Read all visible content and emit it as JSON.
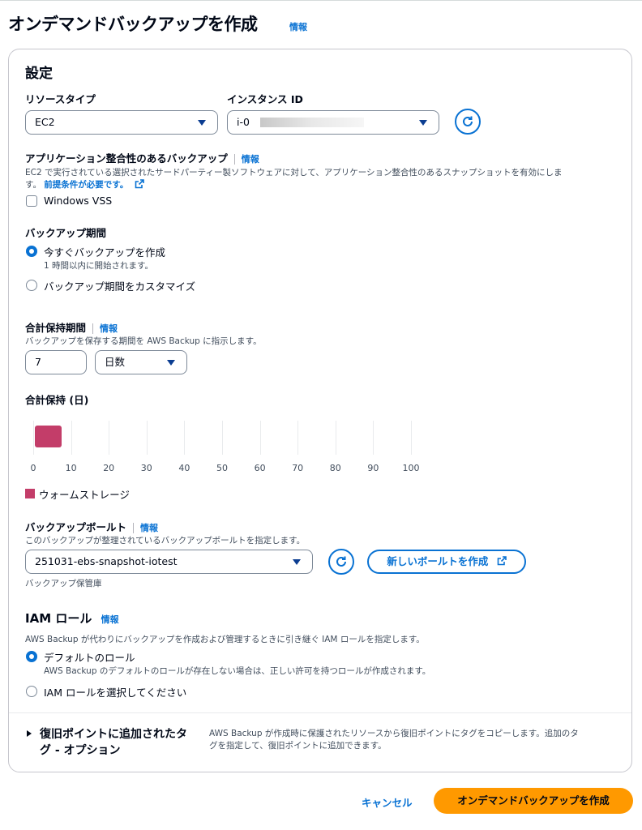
{
  "page": {
    "title": "オンデマンドバックアップを作成",
    "info": "情報"
  },
  "settings": {
    "heading": "設定",
    "resource_type": {
      "label": "リソースタイプ",
      "value": "EC2"
    },
    "instance_id": {
      "label": "インスタンス ID",
      "value": "i-0"
    },
    "app_consistent": {
      "label": "アプリケーション整合性のあるバックアップ",
      "info": "情報",
      "desc": "EC2 で実行されている選択されたサードパーティー製ソフトウェアに対して、アプリケーション整合性のあるスナップショットを有効にしま",
      "desc2": "す。",
      "prereq_link": "前提条件が必要です。",
      "checkbox_label": "Windows VSS",
      "checkbox_checked": false
    },
    "backup_window": {
      "label": "バックアップ期間",
      "options": [
        {
          "label": "今すぐバックアップを作成",
          "sub": "1 時間以内に開始されます。",
          "selected": true
        },
        {
          "label": "バックアップ期間をカスタマイズ",
          "selected": false
        }
      ]
    },
    "retention": {
      "label": "合計保持期間",
      "info": "情報",
      "desc": "バックアップを保存する期間を AWS Backup に指示します。",
      "value": "7",
      "unit": "日数"
    },
    "retention_chart": {
      "title": "合計保持 (日)",
      "legend": "ウォームストレージ",
      "color": "#c33d69"
    },
    "vault": {
      "label": "バックアップボールト",
      "info": "情報",
      "desc": "このバックアップが整理されているバックアップボールトを指定します。",
      "value": "251031-ebs-snapshot-iotest",
      "create_button": "新しいボールトを作成",
      "footnote": "バックアップ保管庫"
    },
    "iam": {
      "label": "IAM ロール",
      "info": "情報",
      "desc": "AWS Backup が代わりにバックアップを作成および管理するときに引き継ぐ IAM ロールを指定します。",
      "options": [
        {
          "label": "デフォルトのロール",
          "sub": "AWS Backup のデフォルトのロールが存在しない場合は、正しい許可を持つロールが作成されます。",
          "selected": true
        },
        {
          "label": "IAM ロールを選択してください",
          "selected": false
        }
      ]
    },
    "tags": {
      "title_line1": "復旧ポイントに追加されたタ",
      "title_line2": "グ - オプション",
      "desc_line1": "AWS Backup が作成時に保護されたリソースから復旧ポイントにタグをコピーします。追加のタ",
      "desc_line2": "グを指定して、復旧ポイントに追加できます。"
    }
  },
  "footer": {
    "cancel": "キャンセル",
    "submit": "オンデマンドバックアップを作成"
  },
  "chart_data": {
    "type": "bar",
    "title": "合計保持 (日)",
    "x_ticks": [
      0,
      10,
      20,
      30,
      40,
      50,
      60,
      70,
      80,
      90,
      100
    ],
    "xlim": [
      0,
      100
    ],
    "series": [
      {
        "name": "ウォームストレージ",
        "start": 0,
        "end": 7,
        "color": "#c33d69"
      }
    ],
    "grid": true,
    "legend_position": "bottom-left"
  },
  "icons": {
    "refresh": "refresh-icon",
    "external": "external-link-icon",
    "caret": "caret-down-icon",
    "expand": "expand-triangle-icon"
  }
}
